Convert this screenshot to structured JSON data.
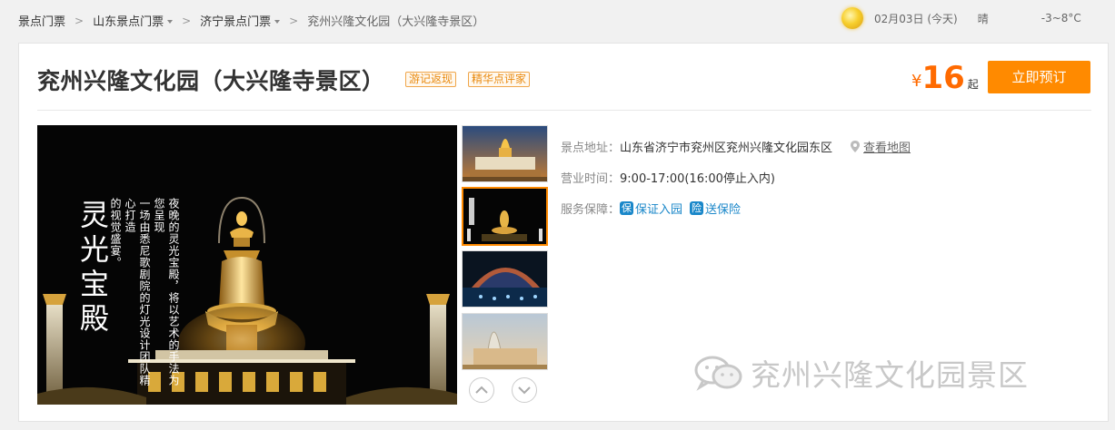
{
  "breadcrumb": {
    "items": [
      "景点门票",
      "山东景点门票",
      "济宁景点门票"
    ],
    "separator": ">",
    "current": "兖州兴隆文化园（大兴隆寺景区）"
  },
  "weather": {
    "icon": "sun-icon",
    "date": "02月03日 (今天)",
    "condition": "晴",
    "temperature": "-3~8°C"
  },
  "attraction": {
    "title": "兖州兴隆文化园（大兴隆寺景区）",
    "tags": [
      "游记返现",
      "精华点评家"
    ],
    "price": {
      "currency": "¥",
      "amount": "16",
      "suffix": "起"
    },
    "book_label": "立即预订"
  },
  "gallery": {
    "main_caption_title": "灵光宝殿",
    "main_caption_text": [
      "夜晚的灵光宝殿，将以艺术的手法为您呈现",
      "一场由悉尼歌剧院的灯光设计团队精心打造",
      "的视觉盛宴。"
    ],
    "thumbnail_count": 4,
    "active_thumbnail": 2,
    "prev_icon": "chevron-up-icon",
    "next_icon": "chevron-down-icon"
  },
  "info": {
    "address_label": "景点地址：",
    "address": "山东省济宁市兖州区兖州兴隆文化园东区",
    "map_label": "查看地图",
    "hours_label": "营业时间：",
    "hours": "9:00-17:00(16:00停止入内)",
    "service_label": "服务保障：",
    "services": [
      {
        "icon_char": "保",
        "label": "保证入园"
      },
      {
        "icon_char": "险",
        "label": "送保险"
      }
    ]
  },
  "watermark": {
    "icon": "wechat-icon",
    "text": "兖州兴隆文化园景区"
  },
  "colors": {
    "accent": "#ff8a00",
    "price": "#ff6a00",
    "tag": "#e98a10",
    "link": "#1a87c9"
  }
}
